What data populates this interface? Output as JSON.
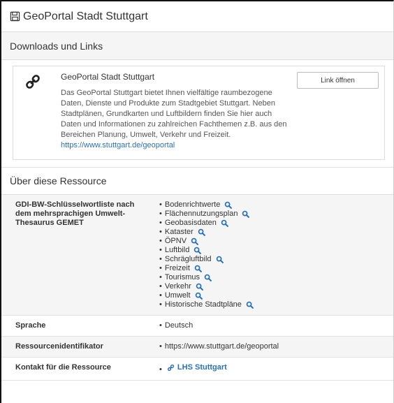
{
  "header": {
    "title": "GeoPortal Stadt Stuttgart",
    "icon": "save-icon"
  },
  "downloads": {
    "heading": "Downloads und Links",
    "card": {
      "icon": "link-icon",
      "title": "GeoPortal Stadt Stuttgart",
      "description": "Das GeoPortal Stuttgart bietet Ihnen vielfältige raumbezogene Daten, Dienste und Produkte zum Stadtgebiet Stuttgart. Neben Stadtplänen, Grundkarten und Luftbildern finden Sie hier auch Daten und Informationen zu zahlreichen Fachthemen z.B. aus den Bereichen Planung, Umwelt, Verkehr und Freizeit.",
      "url": "https://www.stuttgart.de/geoportal",
      "button_label": "Link öffnen"
    }
  },
  "about": {
    "heading": "Über diese Ressource",
    "keywords_label": "GDI-BW-Schlüsselwortliste nach dem mehrsprachigen Umwelt-Thesaurus GEMET",
    "keywords": [
      "Bodenrichtwerte",
      "Flächennutzungsplan",
      "Geobasisdaten",
      "Kataster",
      "ÖPNV",
      "Luftbild",
      "Schrägluftbild",
      "Freizeit",
      "Tourismus",
      "Verkehr",
      "Umwelt",
      "Historische Stadtpläne"
    ],
    "language_label": "Sprache",
    "language": "Deutsch",
    "identifier_label": "Ressourcenidentifikator",
    "identifier": "https://www.stuttgart.de/geoportal",
    "contact_label": "Kontakt für die Ressource",
    "contact": "LHS Stuttgart"
  },
  "colors": {
    "link": "#2b70b5",
    "search_icon": "#2b70b5",
    "row_alt": "#f5f5f5"
  }
}
